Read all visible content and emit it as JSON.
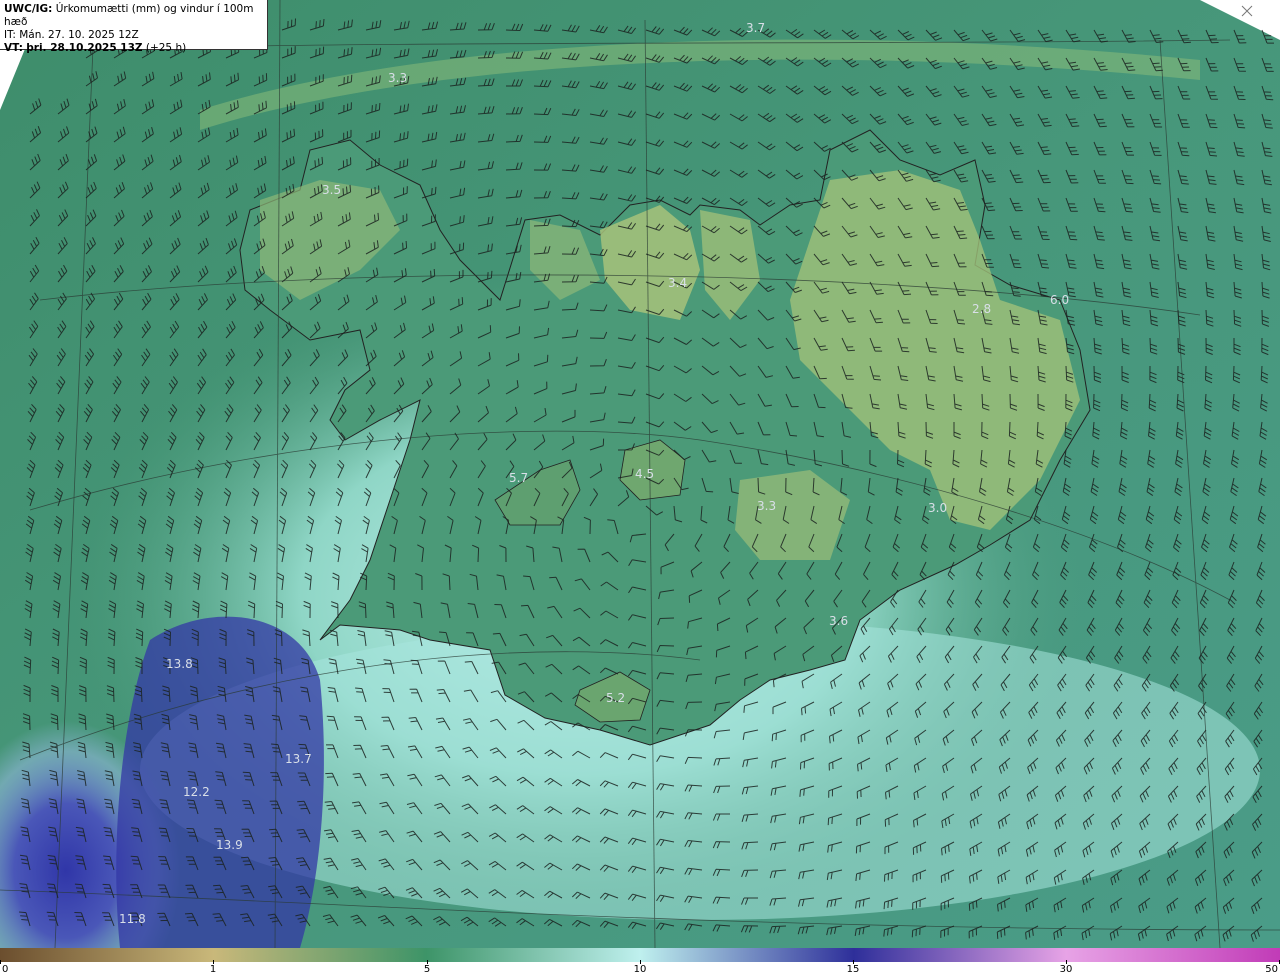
{
  "header": {
    "product": "UWC/IG:",
    "title": "Úrkomumætti (mm) og vindur í 100m hæð",
    "it_line": "IT: Mán. 27. 10. 2025 12Z",
    "vt_label": "VT:",
    "vt_value": "þri. 28.10.2025 13Z",
    "vt_suffix": "(+25 h)"
  },
  "map_values": [
    "3.7",
    "3.3",
    "3.5",
    "3.4",
    "2.8",
    "6.0",
    "4.5",
    "5.7",
    "3.3",
    "3.0",
    "3.6",
    "5.2",
    "13.8",
    "13.7",
    "12.2",
    "13.9",
    "11.8"
  ],
  "colorbar": {
    "ticks": [
      "0",
      "1",
      "5",
      "10",
      "15",
      "30",
      "50"
    ],
    "colors": [
      "#6b4e2e",
      "#c9b87a",
      "#3d9468",
      "#bff0ee",
      "#2e2f9a",
      "#e7a3e6",
      "#c13bb7"
    ]
  },
  "colors": {
    "sea_green": "#3f8d6c",
    "land_green": "#7db574",
    "precip_light": "#b7eee9",
    "precip_blue": "#3d3fae"
  }
}
